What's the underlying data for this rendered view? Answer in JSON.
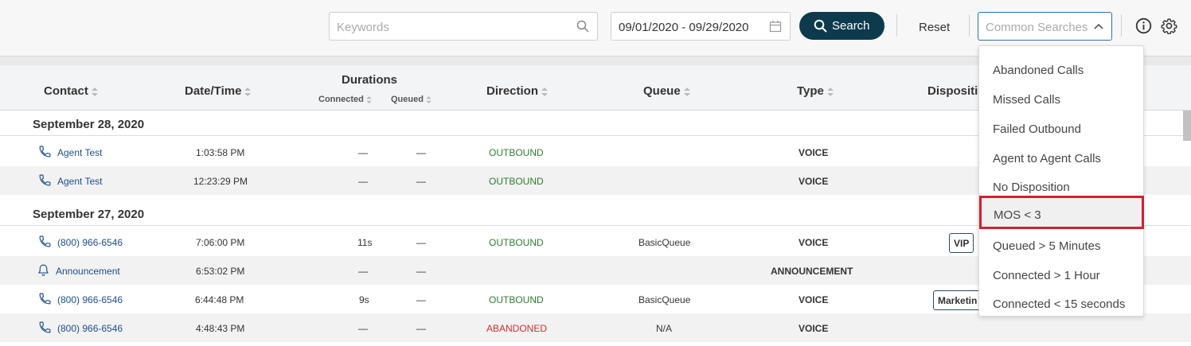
{
  "toolbar": {
    "keywords_placeholder": "Keywords",
    "date_range": "09/01/2020 - 09/29/2020",
    "search_label": "Search",
    "reset_label": "Reset",
    "common_searches_placeholder": "Common Searches"
  },
  "table": {
    "headers": {
      "contact": "Contact",
      "datetime": "Date/Time",
      "durations": "Durations",
      "connected": "Connected",
      "queued": "Queued",
      "direction": "Direction",
      "queue": "Queue",
      "type": "Type",
      "disposition": "Dispositi"
    },
    "groups": [
      "September 28, 2020",
      "September 27, 2020"
    ],
    "rows": [
      {
        "contact": "Agent Test",
        "icon": "phone-icon",
        "time": "1:03:58 PM",
        "connected": "—",
        "queued": "—",
        "direction": "OUTBOUND",
        "queue": "",
        "type": "VOICE",
        "disposition": ""
      },
      {
        "contact": "Agent Test",
        "icon": "phone-icon",
        "time": "12:23:29 PM",
        "connected": "—",
        "queued": "—",
        "direction": "OUTBOUND",
        "queue": "",
        "type": "VOICE",
        "disposition": ""
      },
      {
        "contact": "(800) 966-6546",
        "icon": "phone-icon",
        "time": "7:06:00 PM",
        "connected": "11s",
        "queued": "—",
        "direction": "OUTBOUND",
        "queue": "BasicQueue",
        "type": "VOICE",
        "disposition": "VIP"
      },
      {
        "contact": "Announcement",
        "icon": "bell-icon",
        "time": "6:53:02 PM",
        "connected": "—",
        "queued": "—",
        "direction": "",
        "queue": "",
        "type": "ANNOUNCEMENT",
        "disposition": ""
      },
      {
        "contact": "(800) 966-6546",
        "icon": "phone-icon",
        "time": "6:44:48 PM",
        "connected": "9s",
        "queued": "—",
        "direction": "OUTBOUND",
        "queue": "BasicQueue",
        "type": "VOICE",
        "disposition": "Marketin"
      },
      {
        "contact": "(800) 966-6546",
        "icon": "phone-icon",
        "time": "4:48:43 PM",
        "connected": "—",
        "queued": "—",
        "direction": "ABANDONED",
        "queue": "N/A",
        "type": "VOICE",
        "disposition": ""
      }
    ]
  },
  "dropdown": {
    "items": [
      "Abandoned Calls",
      "Missed Calls",
      "Failed Outbound",
      "Agent to Agent Calls",
      "No Disposition",
      "MOS < 3",
      "Queued > 5 Minutes",
      "Connected > 1 Hour",
      "Connected < 15 seconds"
    ],
    "highlighted": "MOS < 3"
  },
  "colors": {
    "accent": "#0d3a4d",
    "link": "#1c4e8a",
    "outbound": "#2e7d32",
    "abandoned": "#d32f2f",
    "highlight_border": "#d32030"
  }
}
